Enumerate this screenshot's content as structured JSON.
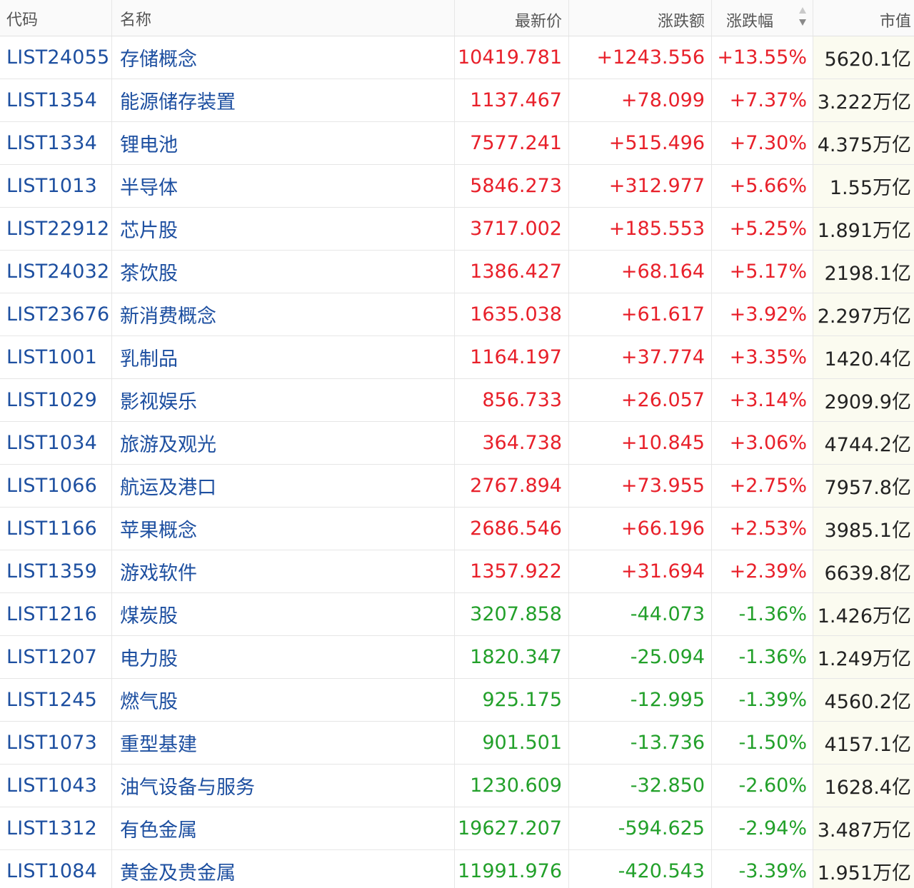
{
  "header": {
    "code": "代码",
    "name": "名称",
    "price": "最新价",
    "change": "涨跌额",
    "pct": "涨跌幅",
    "cap": "市值"
  },
  "colors": {
    "up": "#e8202a",
    "down": "#22a02a",
    "link": "#1d4fa0"
  },
  "rows": [
    {
      "code": "LIST24055",
      "name": "存储概念",
      "price": "10419.781",
      "change": "+1243.556",
      "pct": "+13.55%",
      "cap": "5620.1亿",
      "dir": "up"
    },
    {
      "code": "LIST1354",
      "name": "能源储存装置",
      "price": "1137.467",
      "change": "+78.099",
      "pct": "+7.37%",
      "cap": "3.222万亿",
      "dir": "up"
    },
    {
      "code": "LIST1334",
      "name": "锂电池",
      "price": "7577.241",
      "change": "+515.496",
      "pct": "+7.30%",
      "cap": "4.375万亿",
      "dir": "up"
    },
    {
      "code": "LIST1013",
      "name": "半导体",
      "price": "5846.273",
      "change": "+312.977",
      "pct": "+5.66%",
      "cap": "1.55万亿",
      "dir": "up"
    },
    {
      "code": "LIST22912",
      "name": "芯片股",
      "price": "3717.002",
      "change": "+185.553",
      "pct": "+5.25%",
      "cap": "1.891万亿",
      "dir": "up"
    },
    {
      "code": "LIST24032",
      "name": "茶饮股",
      "price": "1386.427",
      "change": "+68.164",
      "pct": "+5.17%",
      "cap": "2198.1亿",
      "dir": "up"
    },
    {
      "code": "LIST23676",
      "name": "新消费概念",
      "price": "1635.038",
      "change": "+61.617",
      "pct": "+3.92%",
      "cap": "2.297万亿",
      "dir": "up"
    },
    {
      "code": "LIST1001",
      "name": "乳制品",
      "price": "1164.197",
      "change": "+37.774",
      "pct": "+3.35%",
      "cap": "1420.4亿",
      "dir": "up"
    },
    {
      "code": "LIST1029",
      "name": "影视娱乐",
      "price": "856.733",
      "change": "+26.057",
      "pct": "+3.14%",
      "cap": "2909.9亿",
      "dir": "up"
    },
    {
      "code": "LIST1034",
      "name": "旅游及观光",
      "price": "364.738",
      "change": "+10.845",
      "pct": "+3.06%",
      "cap": "4744.2亿",
      "dir": "up"
    },
    {
      "code": "LIST1066",
      "name": "航运及港口",
      "price": "2767.894",
      "change": "+73.955",
      "pct": "+2.75%",
      "cap": "7957.8亿",
      "dir": "up"
    },
    {
      "code": "LIST1166",
      "name": "苹果概念",
      "price": "2686.546",
      "change": "+66.196",
      "pct": "+2.53%",
      "cap": "3985.1亿",
      "dir": "up"
    },
    {
      "code": "LIST1359",
      "name": "游戏软件",
      "price": "1357.922",
      "change": "+31.694",
      "pct": "+2.39%",
      "cap": "6639.8亿",
      "dir": "up"
    },
    {
      "code": "LIST1216",
      "name": "煤炭股",
      "price": "3207.858",
      "change": "-44.073",
      "pct": "-1.36%",
      "cap": "1.426万亿",
      "dir": "down"
    },
    {
      "code": "LIST1207",
      "name": "电力股",
      "price": "1820.347",
      "change": "-25.094",
      "pct": "-1.36%",
      "cap": "1.249万亿",
      "dir": "down"
    },
    {
      "code": "LIST1245",
      "name": "燃气股",
      "price": "925.175",
      "change": "-12.995",
      "pct": "-1.39%",
      "cap": "4560.2亿",
      "dir": "down"
    },
    {
      "code": "LIST1073",
      "name": "重型基建",
      "price": "901.501",
      "change": "-13.736",
      "pct": "-1.50%",
      "cap": "4157.1亿",
      "dir": "down"
    },
    {
      "code": "LIST1043",
      "name": "油气设备与服务",
      "price": "1230.609",
      "change": "-32.850",
      "pct": "-2.60%",
      "cap": "1628.4亿",
      "dir": "down"
    },
    {
      "code": "LIST1312",
      "name": "有色金属",
      "price": "19627.207",
      "change": "-594.625",
      "pct": "-2.94%",
      "cap": "3.487万亿",
      "dir": "down"
    },
    {
      "code": "LIST1084",
      "name": "黄金及贵金属",
      "price": "11991.976",
      "change": "-420.543",
      "pct": "-3.39%",
      "cap": "1.951万亿",
      "dir": "down"
    }
  ]
}
